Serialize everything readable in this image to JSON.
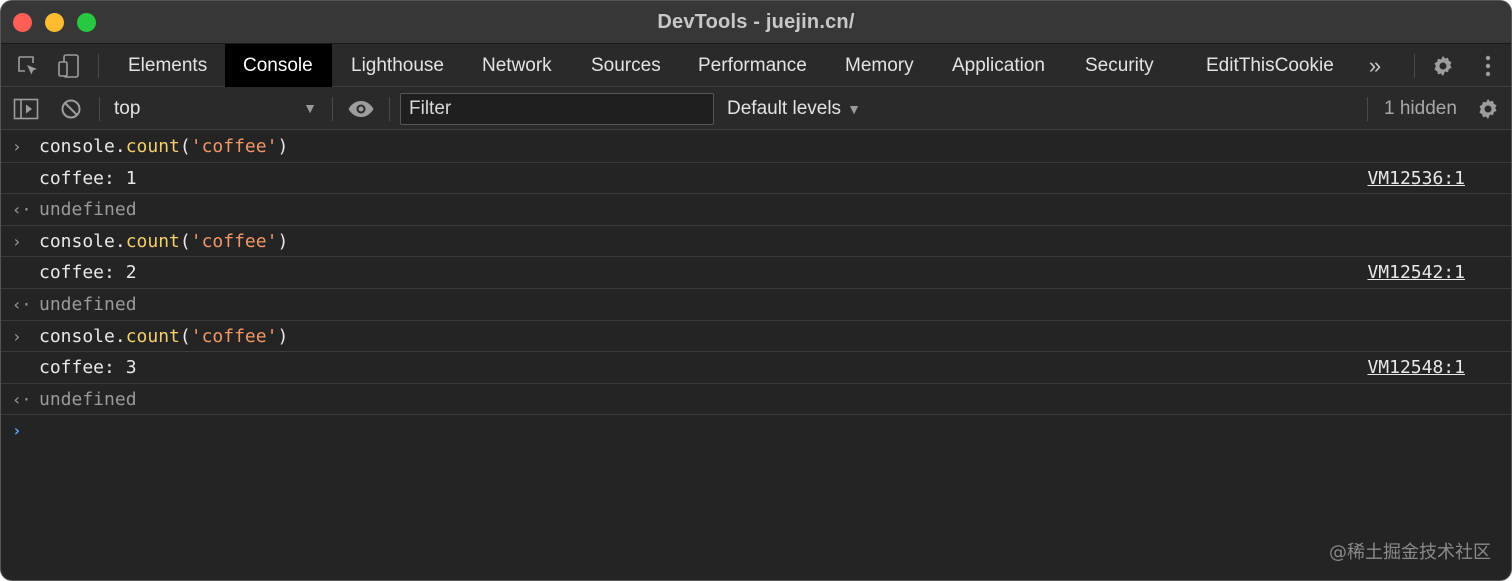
{
  "window": {
    "title": "DevTools - juejin.cn/"
  },
  "tabs": [
    {
      "label": "Elements"
    },
    {
      "label": "Console",
      "active": true
    },
    {
      "label": "Lighthouse"
    },
    {
      "label": "Network"
    },
    {
      "label": "Sources"
    },
    {
      "label": "Performance"
    },
    {
      "label": "Memory"
    },
    {
      "label": "Application"
    },
    {
      "label": "Security"
    },
    {
      "label": "EditThisCookie"
    }
  ],
  "toolbar": {
    "context": "top",
    "filter_placeholder": "Filter",
    "levels": "Default levels",
    "hidden": "1 hidden"
  },
  "console": {
    "entries": [
      {
        "cmd_obj": "console.",
        "cmd_fn": "count",
        "cmd_open": "(",
        "cmd_str": "'coffee'",
        "cmd_close": ")",
        "output": "coffee: 1",
        "source": "VM12536:1",
        "result": "undefined"
      },
      {
        "cmd_obj": "console.",
        "cmd_fn": "count",
        "cmd_open": "(",
        "cmd_str": "'coffee'",
        "cmd_close": ")",
        "output": "coffee: 2",
        "source": "VM12542:1",
        "result": "undefined"
      },
      {
        "cmd_obj": "console.",
        "cmd_fn": "count",
        "cmd_open": "(",
        "cmd_str": "'coffee'",
        "cmd_close": ")",
        "output": "coffee: 3",
        "source": "VM12548:1",
        "result": "undefined"
      }
    ]
  },
  "watermark": "@稀土掘金技术社区",
  "icons": {
    "inspect": "inspect-element-icon",
    "device": "device-toolbar-icon",
    "more_tabs": "more-tabs-icon",
    "settings": "gear-icon",
    "menu": "kebab-menu-icon",
    "sidebar": "sidebar-toggle-icon",
    "clear": "clear-console-icon",
    "eye": "eye-icon"
  }
}
